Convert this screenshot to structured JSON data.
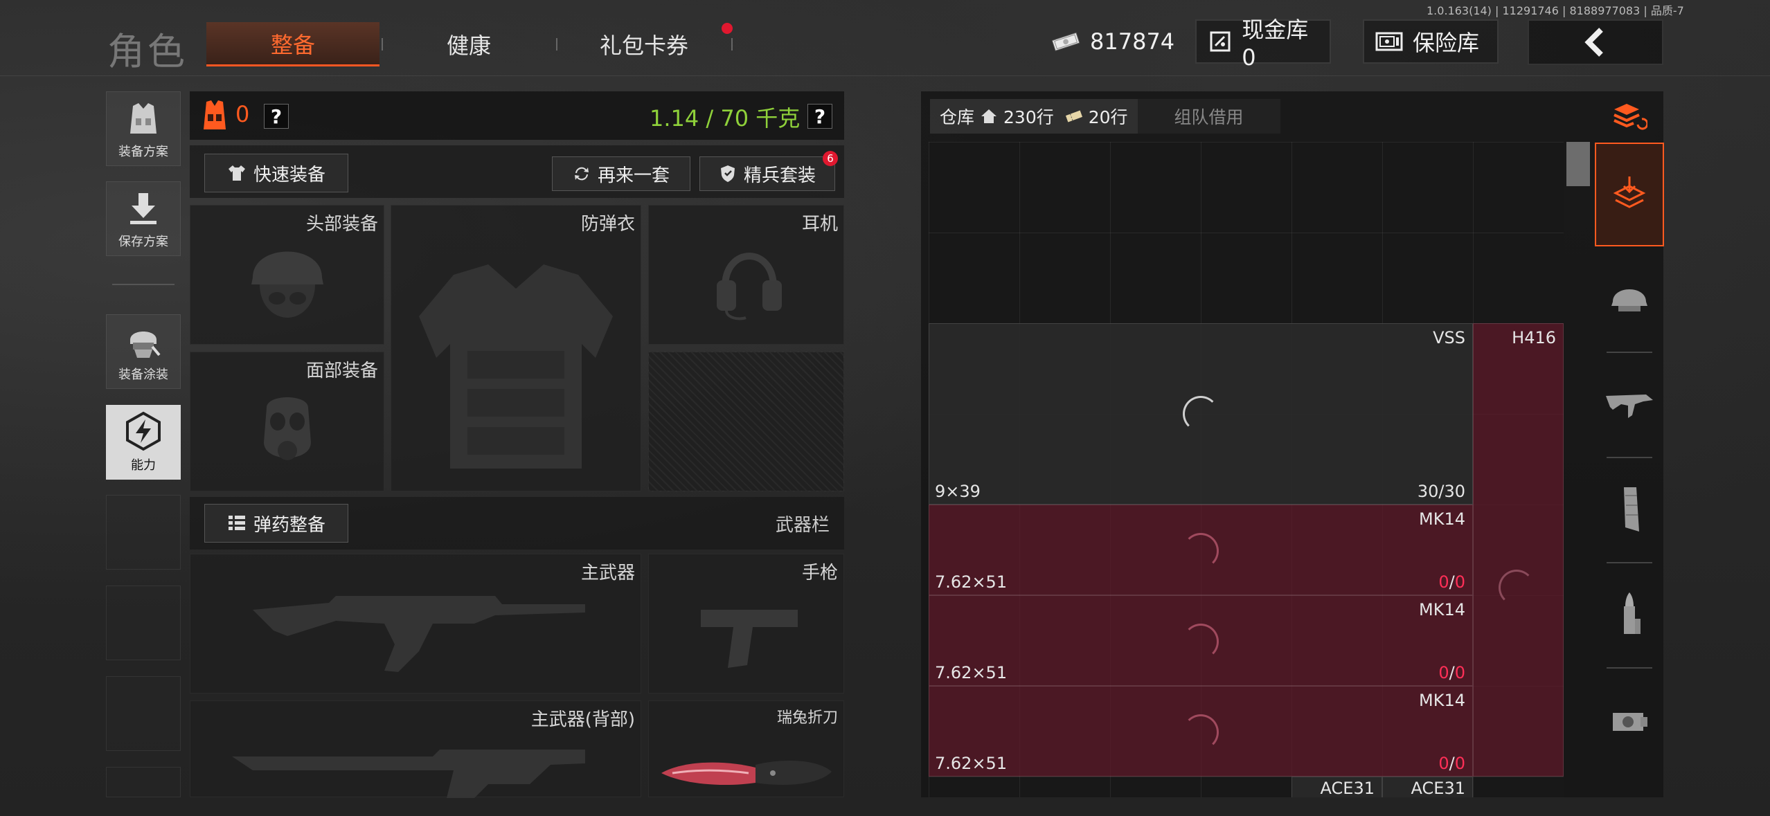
{
  "version": "1.0.163(14) | 11291746 | 8188977083 | 品质-7",
  "header": {
    "title": "角色",
    "tabs": [
      {
        "label": "整备",
        "active": true
      },
      {
        "label": "健康",
        "active": false
      },
      {
        "label": "礼包卡券",
        "active": false,
        "badge_dot": true
      }
    ],
    "currency_amount": "817874",
    "cash_vault_label": "现金库 0",
    "safe_box_label": "保险库"
  },
  "sidebar": {
    "items": [
      {
        "label": "装备方案"
      },
      {
        "label": "保存方案"
      },
      {
        "label": "装备涂装"
      },
      {
        "label": "能力",
        "active": true
      }
    ]
  },
  "equipment": {
    "armor_count": "0",
    "help": "?",
    "weight": "1.14 / 70 千克",
    "quick_equip": "快速装备",
    "again_set": "再来一套",
    "elite_set": "精兵套装",
    "elite_badge": "6",
    "slots": {
      "head": "头部装备",
      "body": "防弹衣",
      "ear": "耳机",
      "face": "面部装备"
    },
    "ammo_button": "弹药整备",
    "weapon_bar": "武器栏",
    "weapon_slots": {
      "primary": "主武器",
      "pistol": "手枪",
      "primary_back": "主武器(背部)",
      "knife": "瑞兔折刀"
    }
  },
  "warehouse": {
    "tab_label": "仓库",
    "rows_home": "230行",
    "rows_ticket": "20行",
    "team_borrow": "组队借用",
    "items": [
      {
        "name": "VSS",
        "caliber": "9×39",
        "amount_a": "30",
        "amount_b": "30",
        "style": "gray"
      },
      {
        "name": "H416",
        "style": "red"
      },
      {
        "name": "MK14",
        "caliber": "7.62×51",
        "amount_a": "0",
        "amount_b": "0",
        "style": "red"
      },
      {
        "name": "MK14",
        "caliber": "7.62×51",
        "amount_a": "0",
        "amount_b": "0",
        "style": "red"
      },
      {
        "name": "MK14",
        "caliber": "7.62×51",
        "amount_a": "0",
        "amount_b": "0",
        "style": "red"
      },
      {
        "name": "ACE31",
        "style": "gray"
      },
      {
        "name": "ACE31",
        "style": "gray"
      }
    ]
  },
  "colors": {
    "accent": "#ff5a1f",
    "weight_green": "#8fd13a",
    "alert_red": "#ff2f57"
  }
}
